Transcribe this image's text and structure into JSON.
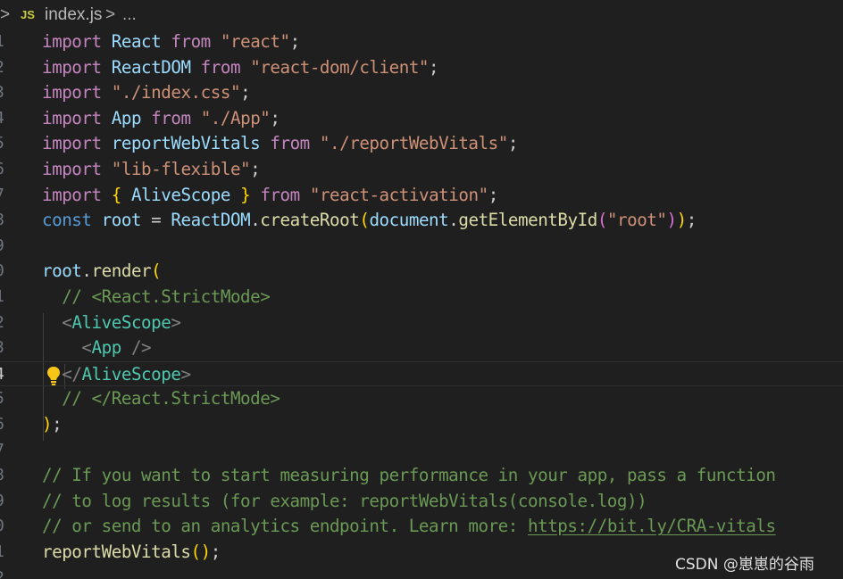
{
  "breadcrumb": {
    "chevron": ">",
    "lang_badge": "JS",
    "file": "index.js",
    "separator": ">",
    "ellipsis": "..."
  },
  "lines": [
    {
      "n": "1",
      "tokens": [
        [
          "kw",
          "import"
        ],
        [
          "plain",
          " "
        ],
        [
          "var",
          "React"
        ],
        [
          "plain",
          " "
        ],
        [
          "kw",
          "from"
        ],
        [
          "plain",
          " "
        ],
        [
          "str",
          "\"react\""
        ],
        [
          "plain",
          ";"
        ]
      ]
    },
    {
      "n": "2",
      "tokens": [
        [
          "kw",
          "import"
        ],
        [
          "plain",
          " "
        ],
        [
          "var",
          "ReactDOM"
        ],
        [
          "plain",
          " "
        ],
        [
          "kw",
          "from"
        ],
        [
          "plain",
          " "
        ],
        [
          "str",
          "\"react-dom/client\""
        ],
        [
          "plain",
          ";"
        ]
      ]
    },
    {
      "n": "3",
      "tokens": [
        [
          "kw",
          "import"
        ],
        [
          "plain",
          " "
        ],
        [
          "str",
          "\"./index.css\""
        ],
        [
          "plain",
          ";"
        ]
      ]
    },
    {
      "n": "4",
      "tokens": [
        [
          "kw",
          "import"
        ],
        [
          "plain",
          " "
        ],
        [
          "var",
          "App"
        ],
        [
          "plain",
          " "
        ],
        [
          "kw",
          "from"
        ],
        [
          "plain",
          " "
        ],
        [
          "str",
          "\"./App\""
        ],
        [
          "plain",
          ";"
        ]
      ]
    },
    {
      "n": "5",
      "tokens": [
        [
          "kw",
          "import"
        ],
        [
          "plain",
          " "
        ],
        [
          "var",
          "reportWebVitals"
        ],
        [
          "plain",
          " "
        ],
        [
          "kw",
          "from"
        ],
        [
          "plain",
          " "
        ],
        [
          "str",
          "\"./reportWebVitals\""
        ],
        [
          "plain",
          ";"
        ]
      ]
    },
    {
      "n": "6",
      "tokens": [
        [
          "kw",
          "import"
        ],
        [
          "plain",
          " "
        ],
        [
          "str",
          "\"lib-flexible\""
        ],
        [
          "plain",
          ";"
        ]
      ]
    },
    {
      "n": "7",
      "tokens": [
        [
          "kw",
          "import"
        ],
        [
          "plain",
          " "
        ],
        [
          "p1",
          "{"
        ],
        [
          "plain",
          " "
        ],
        [
          "var",
          "AliveScope"
        ],
        [
          "plain",
          " "
        ],
        [
          "p1",
          "}"
        ],
        [
          "plain",
          " "
        ],
        [
          "kw",
          "from"
        ],
        [
          "plain",
          " "
        ],
        [
          "str",
          "\"react-activation\""
        ],
        [
          "plain",
          ";"
        ]
      ]
    },
    {
      "n": "8",
      "tokens": [
        [
          "kwb",
          "const"
        ],
        [
          "plain",
          " "
        ],
        [
          "var",
          "root"
        ],
        [
          "plain",
          " = "
        ],
        [
          "var",
          "ReactDOM"
        ],
        [
          "plain",
          "."
        ],
        [
          "fn",
          "createRoot"
        ],
        [
          "p1",
          "("
        ],
        [
          "var",
          "document"
        ],
        [
          "plain",
          "."
        ],
        [
          "fn",
          "getElementById"
        ],
        [
          "p2",
          "("
        ],
        [
          "str",
          "\"root\""
        ],
        [
          "p2",
          ")"
        ],
        [
          "p1",
          ")"
        ],
        [
          "plain",
          ";"
        ]
      ]
    },
    {
      "n": "9",
      "tokens": []
    },
    {
      "n": "0",
      "tokens": [
        [
          "var",
          "root"
        ],
        [
          "plain",
          "."
        ],
        [
          "fn",
          "render"
        ],
        [
          "p1",
          "("
        ]
      ]
    },
    {
      "n": "1",
      "tokens": [
        [
          "plain",
          "  "
        ],
        [
          "cmt",
          "// <React.StrictMode>"
        ]
      ]
    },
    {
      "n": "2",
      "tokens": [
        [
          "plain",
          "  "
        ],
        [
          "punc",
          "<"
        ],
        [
          "tag",
          "AliveScope"
        ],
        [
          "punc",
          ">"
        ]
      ]
    },
    {
      "n": "3",
      "tokens": [
        [
          "plain",
          "    "
        ],
        [
          "punc",
          "<"
        ],
        [
          "tag",
          "App"
        ],
        [
          "plain",
          " "
        ],
        [
          "punc",
          "/>"
        ]
      ]
    },
    {
      "n": "4",
      "tokens": [
        [
          "plain",
          "  "
        ],
        [
          "punc",
          "</"
        ],
        [
          "tag",
          "AliveScope"
        ],
        [
          "punc",
          ">"
        ]
      ],
      "active": true
    },
    {
      "n": "5",
      "tokens": [
        [
          "plain",
          "  "
        ],
        [
          "cmt",
          "// </React.StrictMode>"
        ]
      ]
    },
    {
      "n": "6",
      "tokens": [
        [
          "p1",
          ")"
        ],
        [
          "plain",
          ";"
        ]
      ]
    },
    {
      "n": "7",
      "tokens": []
    },
    {
      "n": "8",
      "tokens": [
        [
          "cmt",
          "// If you want to start measuring performance in your app, pass a function"
        ]
      ]
    },
    {
      "n": "9",
      "tokens": [
        [
          "cmt",
          "// to log results (for example: reportWebVitals(console.log))"
        ]
      ]
    },
    {
      "n": "0",
      "tokens": [
        [
          "cmt",
          "// or send to an analytics endpoint. Learn more: "
        ],
        [
          "link",
          "https://bit.ly/CRA-vitals"
        ]
      ]
    },
    {
      "n": "1",
      "tokens": [
        [
          "fn",
          "reportWebVitals"
        ],
        [
          "p1",
          "()"
        ],
        [
          "plain",
          ";"
        ]
      ]
    },
    {
      "n": "2",
      "tokens": []
    }
  ],
  "watermark": "CSDN @崽崽的谷雨",
  "colors": {
    "background": "#1f1f1f",
    "keyword": "#c586c0",
    "storage": "#569cd6",
    "variable": "#9cdcfe",
    "function": "#dcdcaa",
    "string": "#ce9178",
    "comment": "#6a9955",
    "jsx_tag": "#4ec9b0",
    "bracket_1": "#ffd700",
    "bracket_2": "#da70d6"
  },
  "icons": {
    "lightbulb": "lightbulb-icon"
  }
}
